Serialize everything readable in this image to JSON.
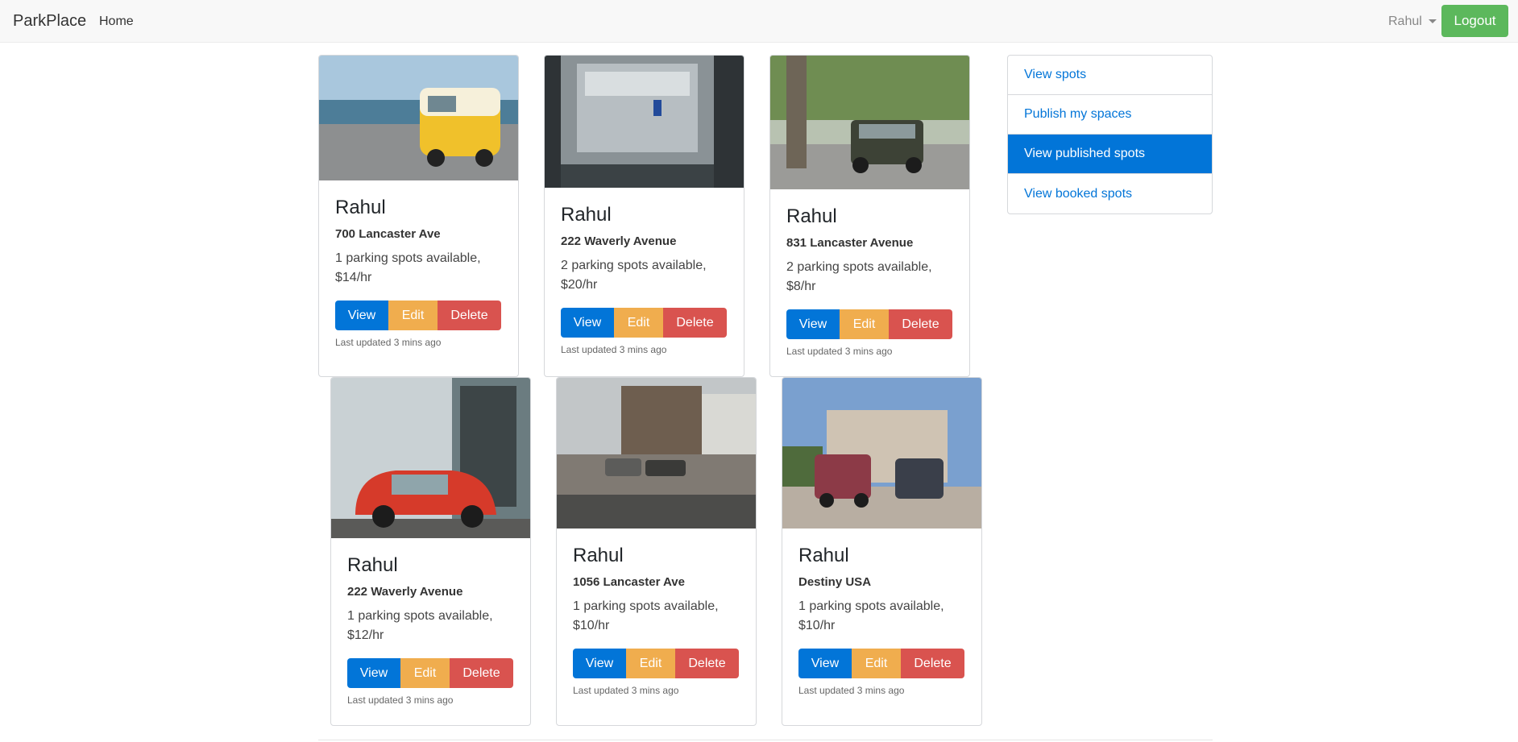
{
  "navbar": {
    "brand": "ParkPlace",
    "home_label": "Home",
    "user_name": "Rahul",
    "logout_label": "Logout"
  },
  "sidebar": {
    "items": [
      {
        "label": "View spots",
        "active": false
      },
      {
        "label": "Publish my spaces",
        "active": false
      },
      {
        "label": "View published spots",
        "active": true
      },
      {
        "label": "View booked spots",
        "active": false
      }
    ]
  },
  "cards": [
    {
      "owner": "Rahul",
      "address": "700 Lancaster Ave",
      "desc": "1 parking spots available, $14/hr",
      "updated": "Last updated 3 mins ago",
      "image": "yellow van by the sea"
    },
    {
      "owner": "Rahul",
      "address": "222 Waverly Avenue",
      "desc": "2 parking spots available, $20/hr",
      "updated": "Last updated 3 mins ago",
      "image": "parking garage overhead"
    },
    {
      "owner": "Rahul",
      "address": "831 Lancaster Avenue",
      "desc": "2 parking spots available, $8/hr",
      "updated": "Last updated 3 mins ago",
      "image": "old car under tree"
    },
    {
      "owner": "Rahul",
      "address": "222 Waverly Avenue",
      "desc": "1 parking spots available, $12/hr",
      "updated": "Last updated 3 mins ago",
      "image": "red car by door"
    },
    {
      "owner": "Rahul",
      "address": "1056 Lancaster Ave",
      "desc": "1 parking spots available, $10/hr",
      "updated": "Last updated 3 mins ago",
      "image": "cars in front of house"
    },
    {
      "owner": "Rahul",
      "address": "Destiny USA",
      "desc": "1 parking spots available, $10/hr",
      "updated": "Last updated 3 mins ago",
      "image": "cars in driveway"
    }
  ],
  "buttons": {
    "view": "View",
    "edit": "Edit",
    "delete": "Delete"
  },
  "colors": {
    "primary": "#0275d8",
    "warning": "#f0ad4e",
    "danger": "#d9534f",
    "success": "#5cb85c"
  }
}
